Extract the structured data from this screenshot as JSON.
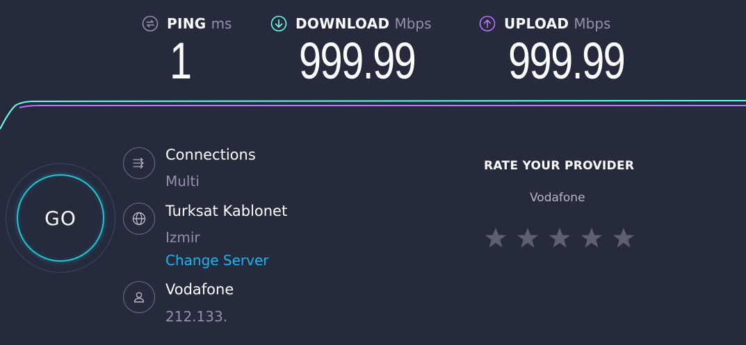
{
  "metrics": {
    "ping": {
      "label": "PING",
      "unit": "ms",
      "value": "1",
      "icon": "ping-icon",
      "color": "#9194a8"
    },
    "download": {
      "label": "DOWNLOAD",
      "unit": "Mbps",
      "value": "999.99",
      "icon": "download-icon",
      "color": "#6afff3"
    },
    "upload": {
      "label": "UPLOAD",
      "unit": "Mbps",
      "value": "999.99",
      "icon": "upload-icon",
      "color": "#bf71ff"
    }
  },
  "go_button": {
    "label": "GO",
    "color": "#1fc8d6"
  },
  "connections": {
    "title": "Connections",
    "value": "Multi",
    "icon": "connections-icon"
  },
  "server": {
    "title": "Turksat Kablonet",
    "location": "Izmir",
    "change_label": "Change Server",
    "icon": "globe-icon"
  },
  "provider": {
    "title": "Vodafone",
    "ip": "212.133.",
    "icon": "user-icon"
  },
  "rating": {
    "title": "RATE YOUR PROVIDER",
    "provider_name": "Vodafone",
    "max_stars": 5,
    "star_color": "#5d6072"
  },
  "colors": {
    "background": "#262a3d",
    "link": "#1ab5f0"
  }
}
